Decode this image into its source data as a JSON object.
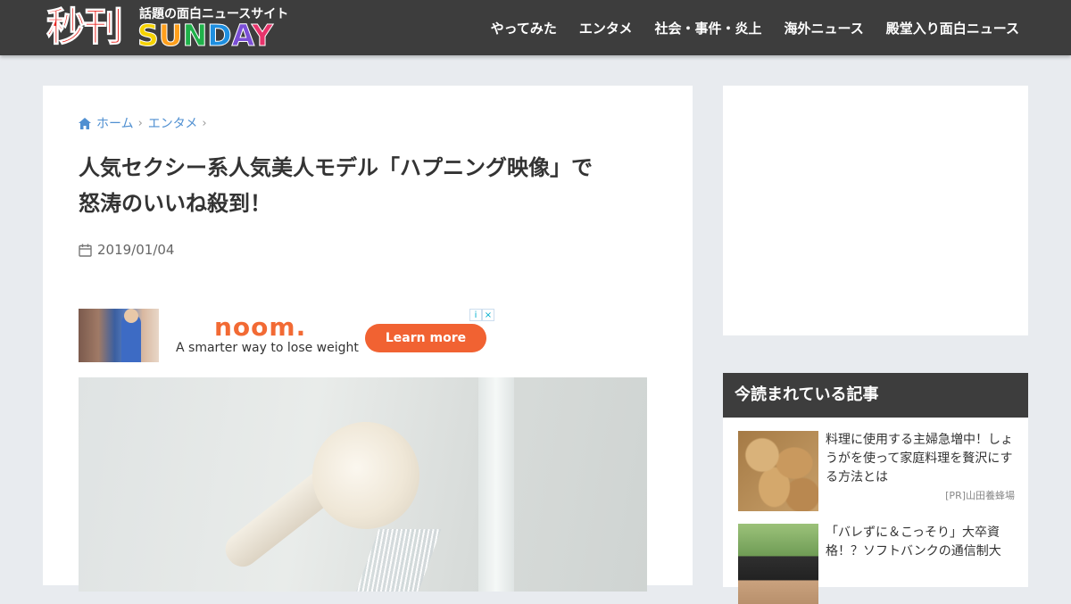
{
  "header": {
    "logo_kanji": "秒刊",
    "logo_tagline": "話題の面白ニュースサイト",
    "logo_sunday": [
      "S",
      "U",
      "N",
      "D",
      "A",
      "Y"
    ],
    "logo_sunday_colors": [
      "#f5d300",
      "#ff9f1c",
      "#1fb24a",
      "#1e8fe0",
      "#7b4fd6",
      "#e8336b"
    ],
    "nav": [
      "やってみた",
      "エンタメ",
      "社会・事件・炎上",
      "海外ニュース",
      "殿堂入り面白ニュース"
    ]
  },
  "article": {
    "breadcrumb": [
      "ホーム",
      "エンタメ"
    ],
    "title_line1": "人気セクシー系人気美人モデル「ハプニング映像」で",
    "title_line2": "怒涛のいいね殺到！",
    "date": "2019/01/04"
  },
  "ad": {
    "brand": "noom.",
    "tagline": "A smarter way to lose weight",
    "button": "Learn more",
    "info_icons": [
      "i",
      "×"
    ]
  },
  "sidebar": {
    "ranking_title": "今読まれている記事",
    "items": [
      {
        "text": "料理に使用する主婦急増中！しょうがを使って家庭料理を贅沢にする方法とは",
        "source": "[PR]山田養蜂場"
      },
      {
        "text": "「バレずに＆こっそり」大卒資格！？ソフトバンクの通信制大",
        "source": ""
      }
    ]
  },
  "colors": {
    "header_bg": "#3d3d3d",
    "page_bg": "#e8ebef",
    "link": "#4f8fd1",
    "ad_button": "#f16232"
  }
}
